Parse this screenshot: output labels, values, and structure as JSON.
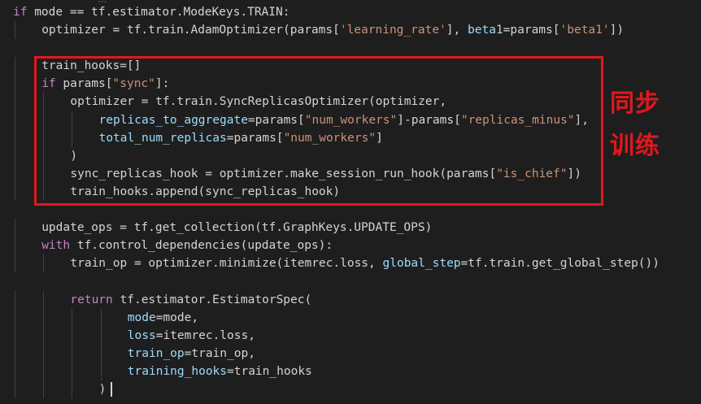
{
  "editor": {
    "top_fragment": "...",
    "annotation": [
      "同步",
      "训练"
    ],
    "lines": [
      {
        "indent": 0,
        "tokens": [
          [
            "keyword",
            "if"
          ],
          [
            "plain",
            " mode == tf.estimator.ModeKeys.TRAIN:"
          ]
        ]
      },
      {
        "indent": 1,
        "tokens": [
          [
            "plain",
            "optimizer = tf.train.AdamOptimizer(params["
          ],
          [
            "string",
            "'learning_rate'"
          ],
          [
            "plain",
            "], "
          ],
          [
            "param",
            "beta1"
          ],
          [
            "plain",
            "=params["
          ],
          [
            "string",
            "'beta1'"
          ],
          [
            "plain",
            "])"
          ]
        ]
      },
      {
        "indent": 0,
        "tokens": []
      },
      {
        "indent": 1,
        "tokens": [
          [
            "plain",
            "train_hooks=[]"
          ]
        ]
      },
      {
        "indent": 1,
        "tokens": [
          [
            "keyword",
            "if"
          ],
          [
            "plain",
            " params["
          ],
          [
            "string",
            "\"sync\""
          ],
          [
            "plain",
            "]:"
          ]
        ]
      },
      {
        "indent": 2,
        "tokens": [
          [
            "plain",
            "optimizer = tf.train.SyncReplicasOptimizer(optimizer,"
          ]
        ]
      },
      {
        "indent": 3,
        "tokens": [
          [
            "param",
            "replicas_to_aggregate"
          ],
          [
            "plain",
            "=params["
          ],
          [
            "string",
            "\"num_workers\""
          ],
          [
            "plain",
            "]-params["
          ],
          [
            "string",
            "\"replicas_minus\""
          ],
          [
            "plain",
            "],"
          ]
        ]
      },
      {
        "indent": 3,
        "tokens": [
          [
            "param",
            "total_num_replicas"
          ],
          [
            "plain",
            "=params["
          ],
          [
            "string",
            "\"num_workers\""
          ],
          [
            "plain",
            "]"
          ]
        ]
      },
      {
        "indent": 2,
        "tokens": [
          [
            "plain",
            ")"
          ]
        ]
      },
      {
        "indent": 2,
        "tokens": [
          [
            "plain",
            "sync_replicas_hook = optimizer.make_session_run_hook(params["
          ],
          [
            "string",
            "\"is_chief\""
          ],
          [
            "plain",
            "])"
          ]
        ]
      },
      {
        "indent": 2,
        "tokens": [
          [
            "plain",
            "train_hooks.append(sync_replicas_hook)"
          ]
        ]
      },
      {
        "indent": 0,
        "tokens": []
      },
      {
        "indent": 1,
        "tokens": [
          [
            "plain",
            "update_ops = tf.get_collection(tf.GraphKeys.UPDATE_OPS)"
          ]
        ]
      },
      {
        "indent": 1,
        "tokens": [
          [
            "keyword",
            "with"
          ],
          [
            "plain",
            " tf.control_dependencies(update_ops):"
          ]
        ]
      },
      {
        "indent": 2,
        "tokens": [
          [
            "plain",
            "train_op = optimizer.minimize(itemrec.loss, "
          ],
          [
            "param",
            "global_step"
          ],
          [
            "plain",
            "=tf.train.get_global_step())"
          ]
        ]
      },
      {
        "indent": 0,
        "tokens": []
      },
      {
        "indent": 2,
        "tokens": [
          [
            "control",
            "return"
          ],
          [
            "plain",
            " tf.estimator.EstimatorSpec("
          ]
        ]
      },
      {
        "indent": 4,
        "tokens": [
          [
            "param",
            "mode"
          ],
          [
            "plain",
            "=mode,"
          ]
        ]
      },
      {
        "indent": 4,
        "tokens": [
          [
            "param",
            "loss"
          ],
          [
            "plain",
            "=itemrec.loss,"
          ]
        ]
      },
      {
        "indent": 4,
        "tokens": [
          [
            "param",
            "train_op"
          ],
          [
            "plain",
            "=train_op,"
          ]
        ]
      },
      {
        "indent": 4,
        "tokens": [
          [
            "param",
            "training_hooks"
          ],
          [
            "plain",
            "=train_hooks"
          ]
        ]
      },
      {
        "indent": 3,
        "tokens": [
          [
            "plain",
            ")"
          ]
        ]
      }
    ]
  },
  "colors": {
    "background": "#1e1e1e",
    "keyword": "#c586c0",
    "string": "#ce9178",
    "param": "#9cdcfe",
    "plain": "#d4d4d4",
    "annotation_red": "#e0181e"
  }
}
